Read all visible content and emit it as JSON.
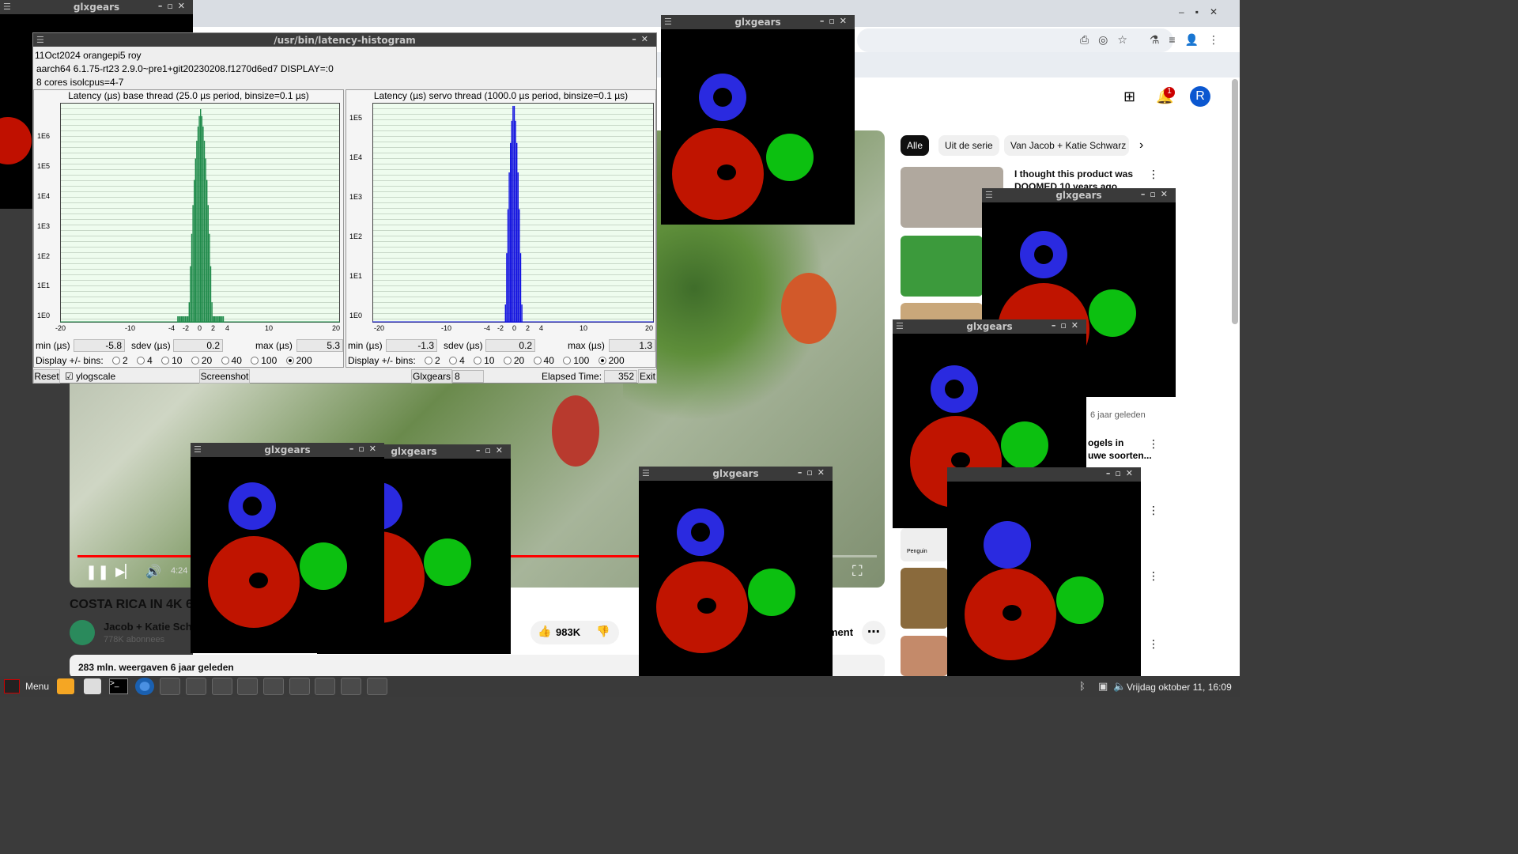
{
  "glxgears": {
    "title": "glxgears"
  },
  "latency": {
    "title": "/usr/bin/latency-histogram",
    "info1": "11Oct2024 orangepi5 roy",
    "info2": "aarch64  6.1.75-rt23  2.9.0~pre1+git20230208.f1270d6ed7  DISPLAY=:0",
    "info3": "8 cores  isolcpus=4-7",
    "min_label": "min (µs)",
    "sdev_label": "sdev (µs)",
    "max_label": "max (µs)",
    "display_label": "Display +/- bins:",
    "bins": [
      "2",
      "4",
      "10",
      "20",
      "40",
      "100",
      "200"
    ],
    "base": {
      "title": "Latency (µs) base thread (25.0 µs period, binsize=0.1 µs)",
      "min": "-5.8",
      "sdev": "0.2",
      "max": "5.3",
      "ylabels": [
        "1E0",
        "1E1",
        "1E2",
        "1E3",
        "1E4",
        "1E5",
        "1E6"
      ]
    },
    "servo": {
      "title": "Latency (µs) servo thread (1000.0 µs period, binsize=0.1 µs)",
      "min": "-1.3",
      "sdev": "0.2",
      "max": "1.3",
      "ylabels": [
        "1E0",
        "1E1",
        "1E2",
        "1E3",
        "1E4",
        "1E5"
      ]
    },
    "xlabels": [
      "-20",
      "-10",
      "-4",
      "-2",
      "0",
      "2",
      "4",
      "10",
      "20"
    ],
    "reset": "Reset",
    "ylogscale": "ylogscale",
    "screenshot": "Screenshot",
    "glxgears_label": "Glxgears",
    "glxgears_value": "8",
    "elapsed_label": "Elapsed Time:",
    "elapsed_value": "352",
    "exit": "Exit"
  },
  "youtube": {
    "chips": [
      "Alle",
      "Uit de serie",
      "Van Jacob + Katie Schwarz"
    ],
    "notification_count": "1",
    "avatar_letter": "R",
    "video_title": "COSTA RICA IN 4K 6",
    "channel": "Jacob + Katie Schw",
    "subscribers": "778K abonnees",
    "likes": "983K",
    "ment": "ment",
    "views": "283 mln. weergaven  6 jaar geleden",
    "time": "4:24",
    "rec1_title": "I thought this product was DOOMED 10 years ago",
    "rec_age": "6 jaar geleden",
    "rec_partial": "ogels in",
    "rec_partial2": "uwe soorten...",
    "penguin": "Penguin"
  },
  "taskbar": {
    "menu": "Menu",
    "clock": "Vrijdag oktober 11, 16:09"
  }
}
